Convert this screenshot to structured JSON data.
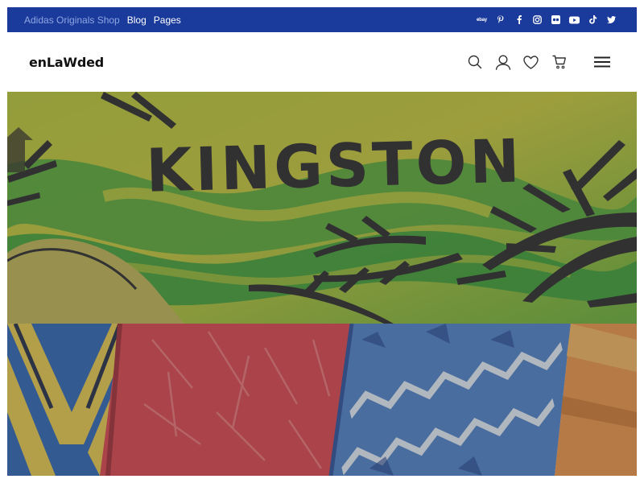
{
  "topbar": {
    "links": [
      {
        "label": "Adidas Originals Shop",
        "style": "dim"
      },
      {
        "label": "Blog",
        "style": "bright"
      },
      {
        "label": "Pages",
        "style": "bright"
      }
    ],
    "social": [
      "ebay-icon",
      "pinterest-icon",
      "facebook-icon",
      "instagram-icon",
      "flickr-icon",
      "youtube-icon",
      "tiktok-icon",
      "twitter-icon"
    ],
    "ebay_text": "ebay",
    "background": "#1a3b9b"
  },
  "header": {
    "logo": "enLaWded",
    "actions": [
      "search-icon",
      "account-icon",
      "wishlist-icon",
      "cart-icon"
    ],
    "menu": "hamburger-menu-icon"
  },
  "hero": {
    "image_text": "KINGSTON"
  }
}
